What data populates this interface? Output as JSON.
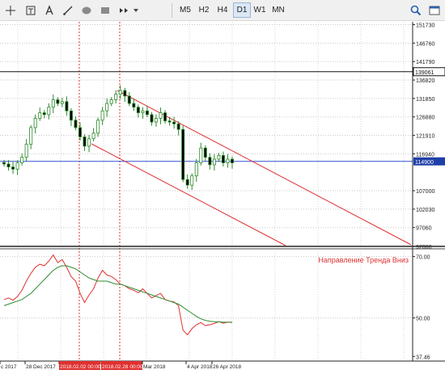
{
  "toolbar": {
    "tools": [
      {
        "name": "crosshair-icon"
      },
      {
        "name": "text-label-icon"
      },
      {
        "name": "text-A-icon"
      },
      {
        "name": "trendline-icon"
      },
      {
        "name": "ellipse-icon"
      },
      {
        "name": "rectangle-icon"
      },
      {
        "name": "arrows-icon"
      }
    ],
    "timeframes": [
      {
        "label": "M5",
        "active": false
      },
      {
        "label": "H2",
        "active": false
      },
      {
        "label": "H4",
        "active": false
      },
      {
        "label": "D1",
        "active": true
      },
      {
        "label": "W1",
        "active": false
      },
      {
        "label": "MN",
        "active": false
      }
    ],
    "right_icons": [
      "search-icon",
      "chart-window-icon"
    ]
  },
  "colors": {
    "channel": "#e03030",
    "hline_blue": "#3050d0",
    "rsi": "#e03030",
    "rsi_ma": "#2e8b2e",
    "candle": "#2e8b2e",
    "label_bg": "#1f3fa8",
    "annotation": "#e03030"
  },
  "chart_data": [
    {
      "type": "candlestick",
      "y_ticks": [
        "151730",
        "146760",
        "141790",
        "136820",
        "131850",
        "126880",
        "121910",
        "116940",
        "107000",
        "102030",
        "97060",
        "92000"
      ],
      "ylim": [
        92000,
        152500
      ],
      "price_labels": {
        "black_line": "139061",
        "blue_line": "114900"
      },
      "black_line_value": 139061,
      "blue_line_value": 114900,
      "candles": {
        "date_range": [
          "Dec 2017",
          "26 Apr 2018"
        ],
        "closes": [
          114200,
          113400,
          112800,
          114500,
          116000,
          119500,
          124000,
          126500,
          128000,
          127500,
          129500,
          131500,
          130500,
          131000,
          128500,
          126000,
          124000,
          121500,
          119000,
          121000,
          122500,
          126000,
          128500,
          130500,
          131500,
          133000,
          134000,
          132500,
          130500,
          129500,
          128000,
          128500,
          127500,
          125500,
          126500,
          128000,
          125800,
          125500,
          125000,
          123500,
          110000,
          108500,
          111000,
          114500,
          118500,
          116000,
          114000,
          115500,
          116500,
          114500,
          115500,
          114500
        ]
      }
    },
    {
      "type": "line",
      "indicator": "RSI",
      "y_ticks": [
        "70.00",
        "50.00",
        "37.46"
      ],
      "ylim": [
        37,
        72
      ],
      "annotation": "Направление Тренда Вниз",
      "series": [
        {
          "values": [
            56,
            56.5,
            55.8,
            57,
            59,
            62,
            64.5,
            66.5,
            67.5,
            67,
            68.5,
            70.5,
            68,
            69,
            66.5,
            63.5,
            62,
            58,
            55,
            57.5,
            59.5,
            63,
            65.5,
            64,
            63.5,
            62.5,
            61,
            60.5,
            59.5,
            59,
            58.2,
            59.5,
            58,
            56.5,
            57.3,
            58,
            56,
            55.5,
            55.2,
            54,
            46,
            44.5,
            46.5,
            47.8,
            48.5,
            47.5,
            47.8,
            48.2,
            48.8,
            48.3,
            48.6,
            48.6
          ]
        },
        {
          "values": [
            54,
            54.5,
            55,
            55.5,
            56,
            57,
            58,
            59.5,
            61,
            62.5,
            64,
            65.5,
            66.5,
            67,
            67,
            66.5,
            66,
            65,
            64,
            63,
            62.5,
            62,
            62,
            62,
            61.5,
            61,
            61,
            60.5,
            60,
            59.5,
            59,
            58.5,
            58,
            57.5,
            57,
            56.5,
            56,
            55.5,
            55,
            54.5,
            53.5,
            52.5,
            51.5,
            50.5,
            49.7,
            49.2,
            48.9,
            48.8,
            48.7,
            48.6,
            48.6,
            48.5
          ]
        }
      ]
    }
  ],
  "x_axis": {
    "labels": [
      {
        "text": "c 2017",
        "highlight": false
      },
      {
        "text": "28 Dec 2017",
        "highlight": false
      },
      {
        "text": "2018.02.02 00:00",
        "highlight": true
      },
      {
        "text": "2018.02.28 00:00",
        "highlight": true
      },
      {
        "text": "Mar 2018",
        "highlight": false
      },
      {
        "text": "4 Apr 2018",
        "highlight": false
      },
      {
        "text": "26 Apr 2018",
        "highlight": false
      }
    ]
  }
}
